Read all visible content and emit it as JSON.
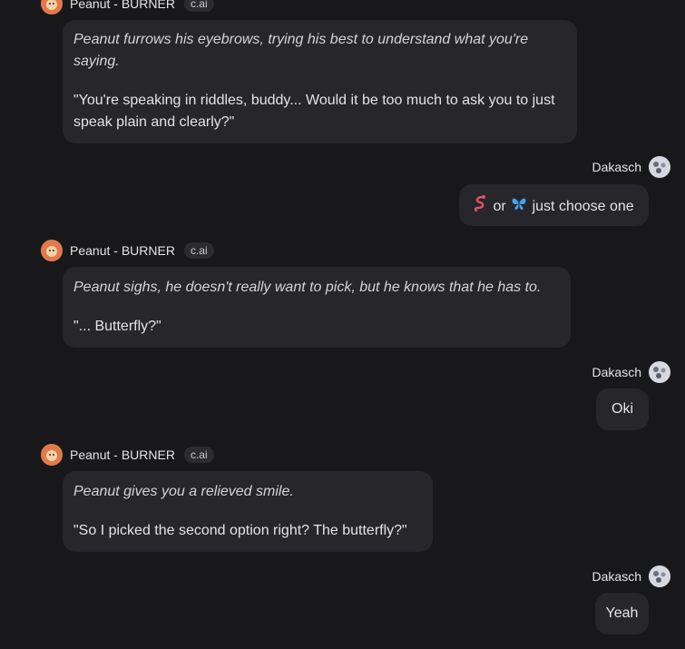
{
  "bot": {
    "name": "Peanut - BURNER",
    "badge": "c.ai"
  },
  "user": {
    "name": "Dakasch"
  },
  "messages": [
    {
      "narration": "Peanut furrows his eyebrows, trying his best to understand what you're saying.",
      "speech": "\"You're speaking in riddles, buddy... Would it be too much to ask you to just speak plain and clearly?\""
    },
    {
      "text_or": "or",
      "text_rest": "just choose one"
    },
    {
      "narration": "Peanut sighs, he doesn't really want to pick, but he knows that he has to.",
      "speech": "\"... Butterfly?\""
    },
    {
      "text": "Oki"
    },
    {
      "narration": "Peanut gives you a relieved smile.",
      "speech": "\"So I picked the second option right? The butterfly?\""
    },
    {
      "text": "Yeah"
    }
  ],
  "icons": {
    "snake": "snake-emoji",
    "butterfly": "butterfly-emoji"
  },
  "colors": {
    "background": "#18181b",
    "bubble": "#26262b",
    "bot_avatar": "#e07a4a"
  }
}
